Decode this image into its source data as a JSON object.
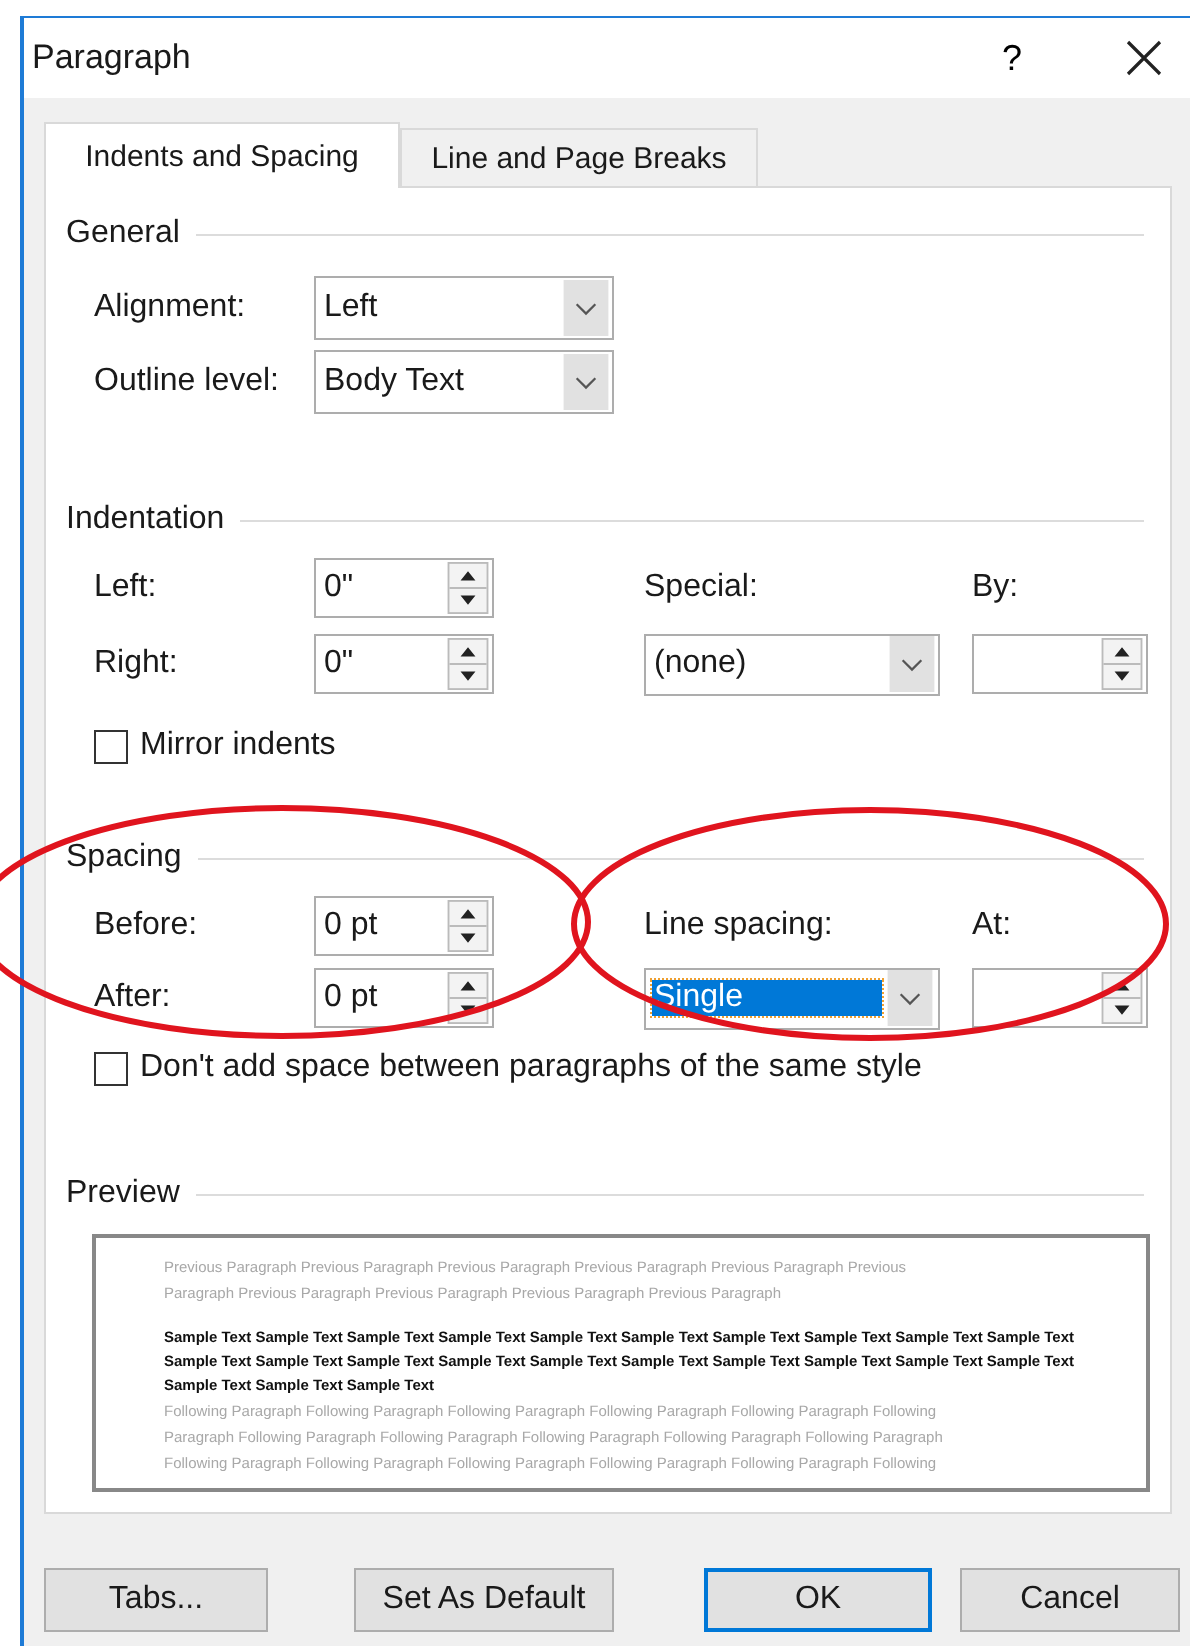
{
  "window": {
    "title": "Paragraph",
    "help": "?"
  },
  "tabs": [
    {
      "label": "Indents and Spacing",
      "selected": true
    },
    {
      "label": "Line and Page Breaks",
      "selected": false
    }
  ],
  "general": {
    "heading": "General",
    "alignment": {
      "label": "Alignment:",
      "value": "Left"
    },
    "outline_level": {
      "label": "Outline level:",
      "value": "Body Text"
    }
  },
  "indentation": {
    "heading": "Indentation",
    "left": {
      "label": "Left:",
      "value": "0\""
    },
    "right": {
      "label": "Right:",
      "value": "0\""
    },
    "special": {
      "label": "Special:",
      "value": "(none)"
    },
    "by": {
      "label": "By:"
    },
    "mirror_indents": {
      "label": "Mirror indents",
      "checked": false
    }
  },
  "spacing": {
    "heading": "Spacing",
    "circled": true,
    "before": {
      "label": "Before:",
      "value": "0 pt"
    },
    "after": {
      "label": "After:",
      "value": "0 pt"
    },
    "line_spacing": {
      "label": "Line spacing:",
      "value": "Single",
      "highlighted": true,
      "circled": true
    },
    "at": {
      "label": "At:"
    },
    "dont_add_space": {
      "label": "Don't add space between paragraphs of the same style",
      "checked": false
    }
  },
  "preview": {
    "heading": "Preview",
    "previous": [
      "Previous Paragraph Previous Paragraph Previous Paragraph Previous Paragraph Previous Paragraph Previous",
      "Paragraph Previous Paragraph Previous Paragraph Previous Paragraph Previous Paragraph"
    ],
    "sample": [
      "Sample Text Sample Text Sample Text Sample Text Sample Text Sample Text Sample Text Sample Text Sample Text Sample Text",
      "Sample Text Sample Text Sample Text Sample Text Sample Text Sample Text Sample Text Sample Text Sample Text Sample Text",
      "Sample Text Sample Text Sample Text"
    ],
    "following": [
      "Following Paragraph Following Paragraph Following Paragraph Following Paragraph Following Paragraph Following",
      "Paragraph Following Paragraph Following Paragraph Following Paragraph Following Paragraph Following Paragraph",
      "Following Paragraph Following Paragraph Following Paragraph Following Paragraph Following Paragraph Following"
    ]
  },
  "buttons": [
    {
      "label": "Tabs...",
      "focused": false
    },
    {
      "label": "Set As Default",
      "focused": false
    },
    {
      "label": "OK",
      "focused": true
    },
    {
      "label": "Cancel",
      "focused": false
    }
  ]
}
